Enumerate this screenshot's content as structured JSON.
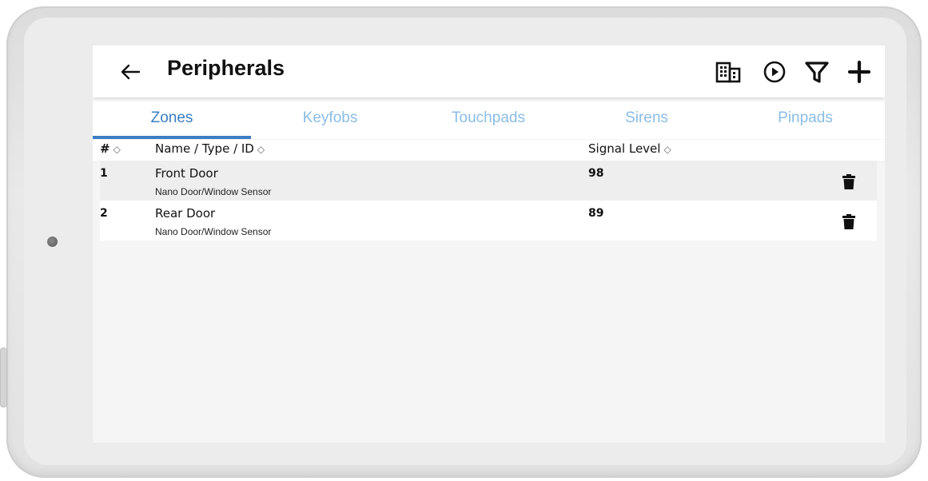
{
  "header": {
    "title": "Peripherals",
    "back_icon": "arrow-left-icon",
    "actions": [
      "building-icon",
      "play-circle-icon",
      "filter-icon",
      "plus-icon"
    ]
  },
  "tabs": [
    {
      "label": "Zones",
      "active": true
    },
    {
      "label": "Keyfobs",
      "active": false
    },
    {
      "label": "Touchpads",
      "active": false
    },
    {
      "label": "Sirens",
      "active": false
    },
    {
      "label": "Pinpads",
      "active": false
    }
  ],
  "table": {
    "columns": {
      "number": "#",
      "name": "Name / Type / ID",
      "signal": "Signal Level",
      "sort_icon": "◇"
    },
    "rows": [
      {
        "number": "1",
        "name": "Front Door",
        "type": "Nano Door/Window Sensor",
        "signal": "98",
        "action_icon": "trash-icon"
      },
      {
        "number": "2",
        "name": "Rear Door",
        "type": "Nano Door/Window Sensor",
        "signal": "89",
        "action_icon": "trash-icon"
      }
    ]
  },
  "colors": {
    "accent": "#3b7fc4",
    "tab_inactive": "#8bbde6",
    "screen_bg": "#f5f5f5"
  }
}
